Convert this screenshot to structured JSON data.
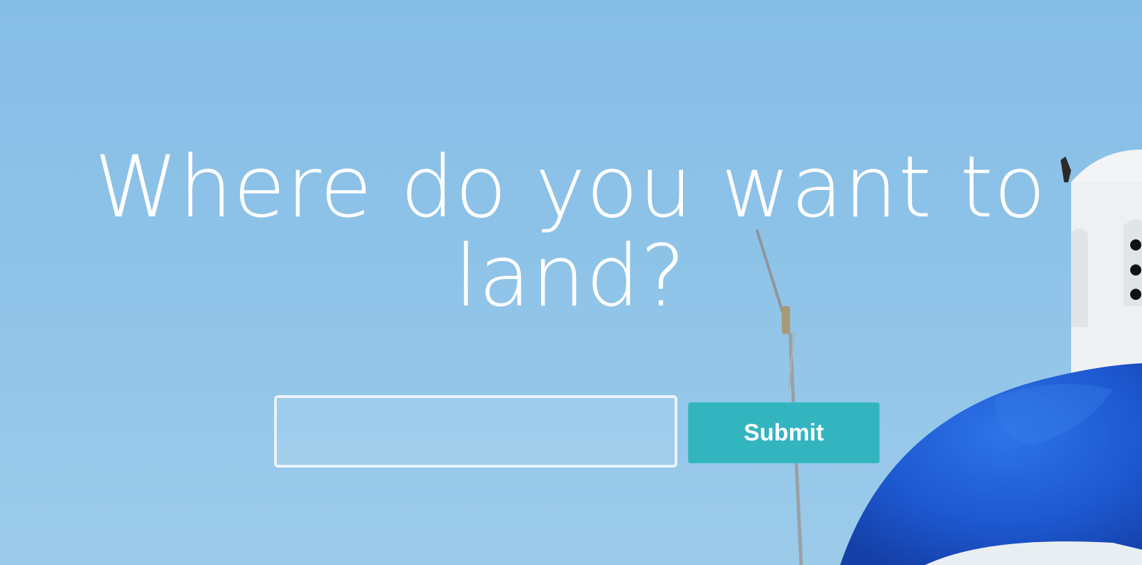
{
  "hero": {
    "headline": "Where do you want to land?"
  },
  "search": {
    "value": "",
    "placeholder": ""
  },
  "submit_button": {
    "label": "Submit"
  },
  "colors": {
    "sky": "#8ec3e8",
    "button": "#33b5c0",
    "dome_blue": "#1f5fd6",
    "tower_white": "#f4f6f7"
  }
}
